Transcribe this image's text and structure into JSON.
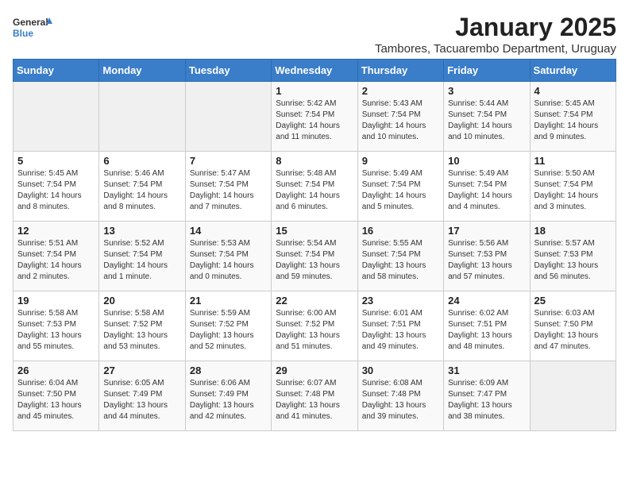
{
  "logo": {
    "general": "General",
    "blue": "Blue"
  },
  "title": "January 2025",
  "subtitle": "Tambores, Tacuarembo Department, Uruguay",
  "days_of_week": [
    "Sunday",
    "Monday",
    "Tuesday",
    "Wednesday",
    "Thursday",
    "Friday",
    "Saturday"
  ],
  "weeks": [
    [
      {
        "day": "",
        "empty": true
      },
      {
        "day": "",
        "empty": true
      },
      {
        "day": "",
        "empty": true
      },
      {
        "day": "1",
        "sunrise": "5:42 AM",
        "sunset": "7:54 PM",
        "daylight": "14 hours and 11 minutes."
      },
      {
        "day": "2",
        "sunrise": "5:43 AM",
        "sunset": "7:54 PM",
        "daylight": "14 hours and 10 minutes."
      },
      {
        "day": "3",
        "sunrise": "5:44 AM",
        "sunset": "7:54 PM",
        "daylight": "14 hours and 10 minutes."
      },
      {
        "day": "4",
        "sunrise": "5:45 AM",
        "sunset": "7:54 PM",
        "daylight": "14 hours and 9 minutes."
      }
    ],
    [
      {
        "day": "5",
        "sunrise": "5:45 AM",
        "sunset": "7:54 PM",
        "daylight": "14 hours and 8 minutes."
      },
      {
        "day": "6",
        "sunrise": "5:46 AM",
        "sunset": "7:54 PM",
        "daylight": "14 hours and 8 minutes."
      },
      {
        "day": "7",
        "sunrise": "5:47 AM",
        "sunset": "7:54 PM",
        "daylight": "14 hours and 7 minutes."
      },
      {
        "day": "8",
        "sunrise": "5:48 AM",
        "sunset": "7:54 PM",
        "daylight": "14 hours and 6 minutes."
      },
      {
        "day": "9",
        "sunrise": "5:49 AM",
        "sunset": "7:54 PM",
        "daylight": "14 hours and 5 minutes."
      },
      {
        "day": "10",
        "sunrise": "5:49 AM",
        "sunset": "7:54 PM",
        "daylight": "14 hours and 4 minutes."
      },
      {
        "day": "11",
        "sunrise": "5:50 AM",
        "sunset": "7:54 PM",
        "daylight": "14 hours and 3 minutes."
      }
    ],
    [
      {
        "day": "12",
        "sunrise": "5:51 AM",
        "sunset": "7:54 PM",
        "daylight": "14 hours and 2 minutes."
      },
      {
        "day": "13",
        "sunrise": "5:52 AM",
        "sunset": "7:54 PM",
        "daylight": "14 hours and 1 minute."
      },
      {
        "day": "14",
        "sunrise": "5:53 AM",
        "sunset": "7:54 PM",
        "daylight": "14 hours and 0 minutes."
      },
      {
        "day": "15",
        "sunrise": "5:54 AM",
        "sunset": "7:54 PM",
        "daylight": "13 hours and 59 minutes."
      },
      {
        "day": "16",
        "sunrise": "5:55 AM",
        "sunset": "7:54 PM",
        "daylight": "13 hours and 58 minutes."
      },
      {
        "day": "17",
        "sunrise": "5:56 AM",
        "sunset": "7:53 PM",
        "daylight": "13 hours and 57 minutes."
      },
      {
        "day": "18",
        "sunrise": "5:57 AM",
        "sunset": "7:53 PM",
        "daylight": "13 hours and 56 minutes."
      }
    ],
    [
      {
        "day": "19",
        "sunrise": "5:58 AM",
        "sunset": "7:53 PM",
        "daylight": "13 hours and 55 minutes."
      },
      {
        "day": "20",
        "sunrise": "5:58 AM",
        "sunset": "7:52 PM",
        "daylight": "13 hours and 53 minutes."
      },
      {
        "day": "21",
        "sunrise": "5:59 AM",
        "sunset": "7:52 PM",
        "daylight": "13 hours and 52 minutes."
      },
      {
        "day": "22",
        "sunrise": "6:00 AM",
        "sunset": "7:52 PM",
        "daylight": "13 hours and 51 minutes."
      },
      {
        "day": "23",
        "sunrise": "6:01 AM",
        "sunset": "7:51 PM",
        "daylight": "13 hours and 49 minutes."
      },
      {
        "day": "24",
        "sunrise": "6:02 AM",
        "sunset": "7:51 PM",
        "daylight": "13 hours and 48 minutes."
      },
      {
        "day": "25",
        "sunrise": "6:03 AM",
        "sunset": "7:50 PM",
        "daylight": "13 hours and 47 minutes."
      }
    ],
    [
      {
        "day": "26",
        "sunrise": "6:04 AM",
        "sunset": "7:50 PM",
        "daylight": "13 hours and 45 minutes."
      },
      {
        "day": "27",
        "sunrise": "6:05 AM",
        "sunset": "7:49 PM",
        "daylight": "13 hours and 44 minutes."
      },
      {
        "day": "28",
        "sunrise": "6:06 AM",
        "sunset": "7:49 PM",
        "daylight": "13 hours and 42 minutes."
      },
      {
        "day": "29",
        "sunrise": "6:07 AM",
        "sunset": "7:48 PM",
        "daylight": "13 hours and 41 minutes."
      },
      {
        "day": "30",
        "sunrise": "6:08 AM",
        "sunset": "7:48 PM",
        "daylight": "13 hours and 39 minutes."
      },
      {
        "day": "31",
        "sunrise": "6:09 AM",
        "sunset": "7:47 PM",
        "daylight": "13 hours and 38 minutes."
      },
      {
        "day": "",
        "empty": true
      }
    ]
  ]
}
